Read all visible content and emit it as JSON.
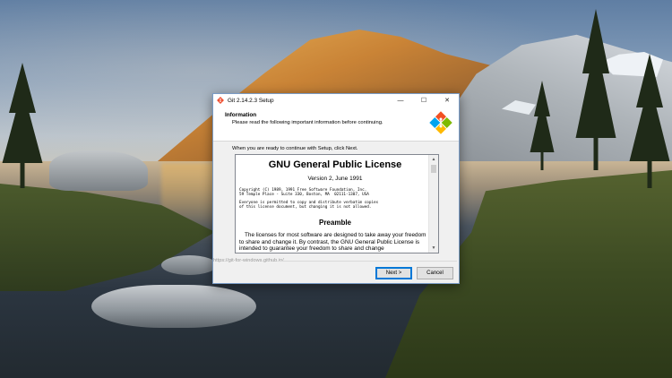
{
  "window": {
    "title": "Git 2.14.2.3 Setup",
    "controls": {
      "minimize": "—",
      "maximize": "☐",
      "close": "✕"
    }
  },
  "header": {
    "title": "Information",
    "subtitle": "Please read the following important information before continuing."
  },
  "intro_text": "When you are ready to continue with Setup, click Next.",
  "license": {
    "title": "GNU General Public License",
    "version": "Version 2, June 1991",
    "copyright": "Copyright (C) 1989, 1991 Free Software Foundation, Inc.\n59 Temple Place - Suite 330, Boston, MA  02111-1307, USA",
    "permission": "Everyone is permitted to copy and distribute verbatim copies\nof this license document, but changing it is not allowed.",
    "preamble_heading": "Preamble",
    "preamble_text": "The licenses for most software are designed to take away your freedom to share and change it. By contrast, the GNU General Public License is intended to guarantee your freedom to share and change"
  },
  "footer": {
    "link": "https://git-for-windows.github.io/"
  },
  "buttons": {
    "next": "Next >",
    "cancel": "Cancel"
  },
  "icons": {
    "title_icon": "git-logo-icon",
    "header_logo": "git-for-windows-logo-icon",
    "scroll_up": "chevron-up-icon",
    "scroll_down": "chevron-down-icon"
  },
  "colors": {
    "accent": "#0078d7",
    "window_border": "#7a9cc6"
  }
}
